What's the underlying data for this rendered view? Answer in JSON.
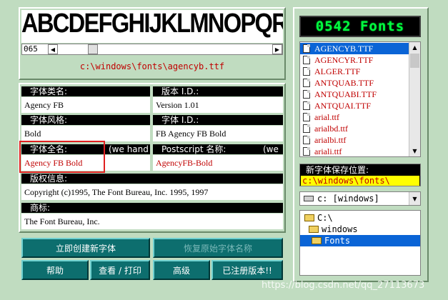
{
  "preview": {
    "sample_text": "ABCDEFGHIJKLMNOPQRST",
    "size_value": "065",
    "font_path": "c:\\windows\\fonts\\agencyb.ttf"
  },
  "fields": {
    "family_label": "字体类名:",
    "family_value": "Agency FB",
    "version_label": "版本 I.D.:",
    "version_value": "Version 1.01",
    "style_label": "字体风格:",
    "style_value": "Bold",
    "font_id_label": "字体 I.D.:",
    "font_id_value": "FB Agency FB Bold",
    "fullname_label": "字体全名:",
    "fullname_extra": "(we hand",
    "fullname_value": "Agency FB Bold",
    "postscript_label": "Postscript 名称:",
    "postscript_extra": "(we",
    "postscript_value": "AgencyFB-Bold",
    "copyright_label": "版权信息:",
    "copyright_value": "Copyright (c)1995, The Font Bureau, Inc. 1995, 1997",
    "trademark_label": "商标:",
    "trademark_value": "The Font Bureau, Inc."
  },
  "buttons": {
    "create": "立即创建新字体",
    "restore": "恢复原始字体名称",
    "help": "帮助",
    "view_print": "查看 / 打印",
    "advanced": "高级",
    "registered": "已注册版本!!"
  },
  "right": {
    "lcd_title": "0542 Fonts",
    "files": [
      "AGENCYB.TTF",
      "AGENCYR.TTF",
      "ALGER.TTF",
      "ANTQUAB.TTF",
      "ANTQUABI.TTF",
      "ANTQUAI.TTF",
      "arial.ttf",
      "arialbd.ttf",
      "arialbi.ttf",
      "ariali.ttf"
    ],
    "save_label": "新字体保存位置:",
    "save_path": "c:\\windows\\fonts\\",
    "drive_value": "c: [windows]",
    "tree": [
      "C:\\",
      "windows",
      "Fonts"
    ]
  },
  "watermark": "https://blog.csdn.net/qq_27113673",
  "colors": {
    "background": "#c0dcc0",
    "button": "#0d6e6e",
    "selected": "#0a64d6",
    "path_yellow": "#ffff00",
    "highlight_box": "#e02020"
  }
}
